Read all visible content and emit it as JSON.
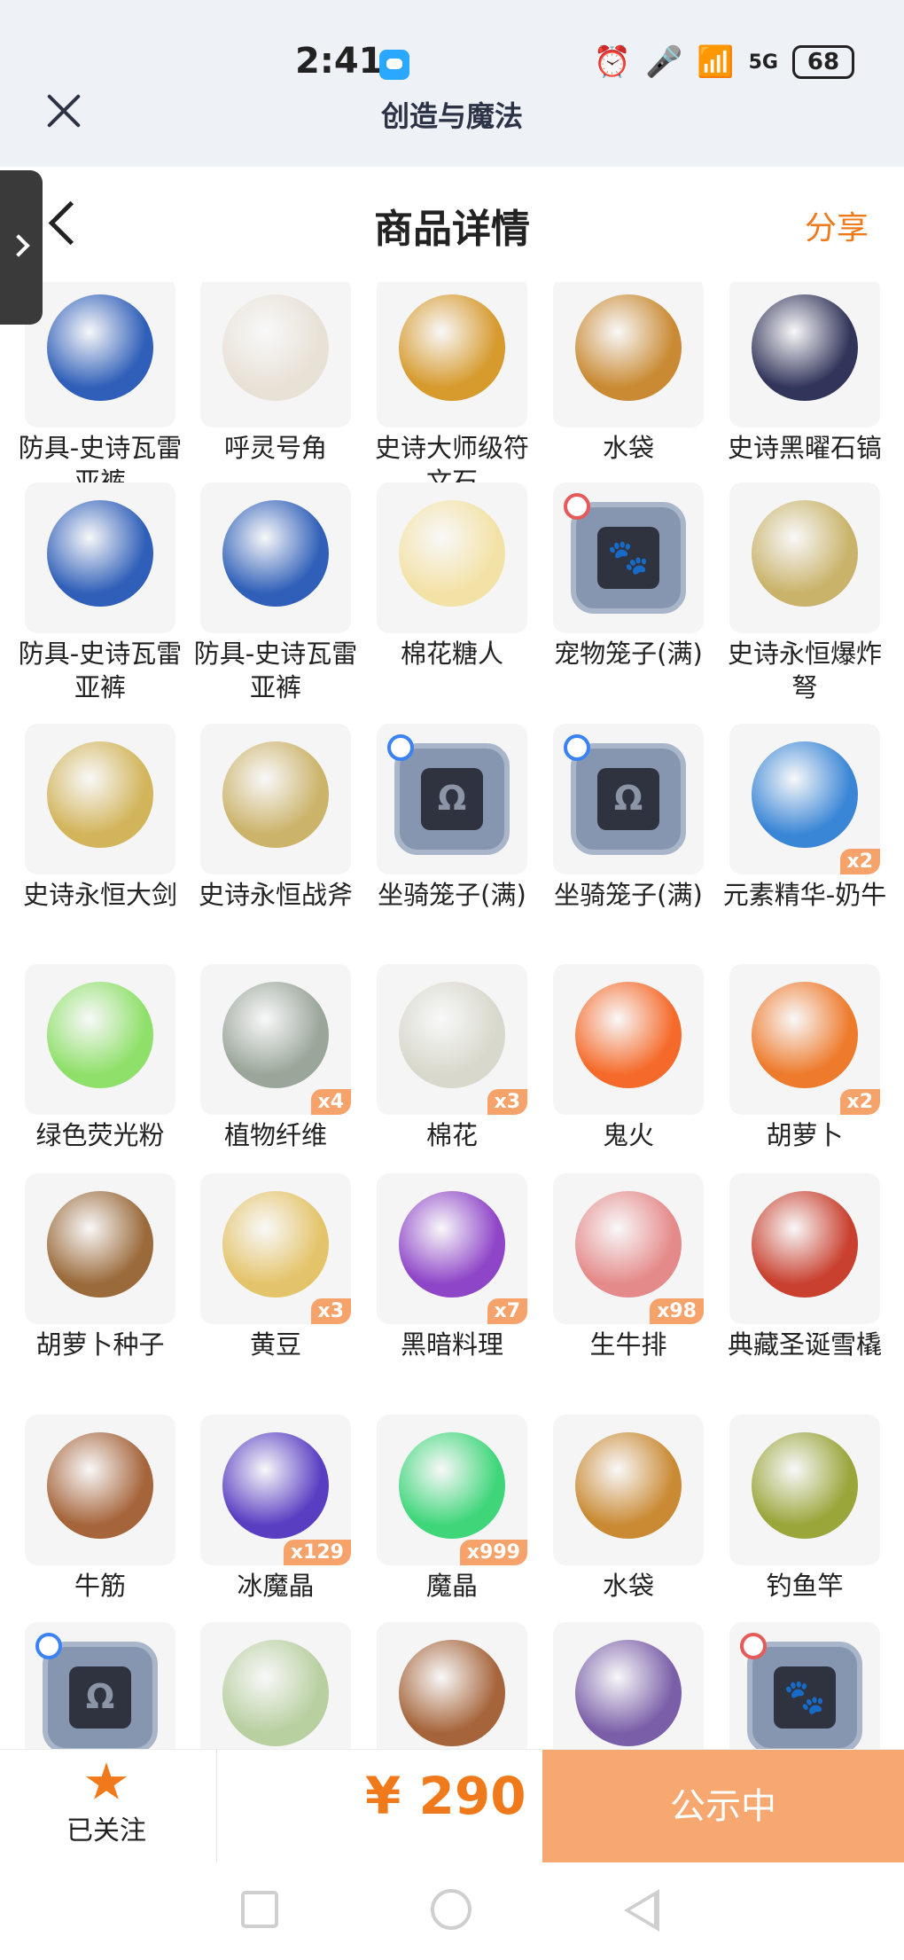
{
  "status_bar": {
    "time": "2:41",
    "network": "5G",
    "battery": "68"
  },
  "app": {
    "title": "创造与魔法"
  },
  "header": {
    "title": "商品详情",
    "share_label": "分享"
  },
  "items": [
    {
      "name": "防具-史诗瓦雷亚裤",
      "qty": "",
      "color": "#2f5fb8"
    },
    {
      "name": "呼灵号角",
      "qty": "",
      "color": "#e8e1d6"
    },
    {
      "name": "史诗大师级符文石",
      "qty": "",
      "color": "#d69a2d"
    },
    {
      "name": "水袋",
      "qty": "",
      "color": "#c98a33"
    },
    {
      "name": "史诗黑曜石镐",
      "qty": "",
      "color": "#32355a"
    },
    {
      "name": "防具-史诗瓦雷亚裤",
      "qty": "",
      "color": "#2f5fb8"
    },
    {
      "name": "防具-史诗瓦雷亚裤",
      "qty": "",
      "color": "#2f5fb8"
    },
    {
      "name": "棉花糖人",
      "qty": "",
      "color": "#f3e2a6"
    },
    {
      "name": "宠物笼子(满)",
      "qty": "",
      "color": "cage-pet"
    },
    {
      "name": "史诗永恒爆炸弩",
      "qty": "",
      "color": "#c9b36a"
    },
    {
      "name": "史诗永恒大剑",
      "qty": "",
      "color": "#d2b45a"
    },
    {
      "name": "史诗永恒战斧",
      "qty": "",
      "color": "#cbb36a"
    },
    {
      "name": "坐骑笼子(满)",
      "qty": "",
      "color": "cage-mount"
    },
    {
      "name": "坐骑笼子(满)",
      "qty": "",
      "color": "cage-mount"
    },
    {
      "name": "元素精华-奶牛",
      "qty": "x2",
      "color": "#3a86d6"
    },
    {
      "name": "绿色荧光粉",
      "qty": "",
      "color": "#8fe06a"
    },
    {
      "name": "植物纤维",
      "qty": "x4",
      "color": "#9aa69a"
    },
    {
      "name": "棉花",
      "qty": "x3",
      "color": "#d8d8cc"
    },
    {
      "name": "鬼火",
      "qty": "",
      "color": "#f56a2a"
    },
    {
      "name": "胡萝卜",
      "qty": "x2",
      "color": "#ee7a2b"
    },
    {
      "name": "胡萝卜种子",
      "qty": "",
      "color": "#9a6a3a"
    },
    {
      "name": "黄豆",
      "qty": "x3",
      "color": "#e4c46a"
    },
    {
      "name": "黑暗料理",
      "qty": "x7",
      "color": "#8e45c8"
    },
    {
      "name": "生牛排",
      "qty": "x98",
      "color": "#e58a8a"
    },
    {
      "name": "典藏圣诞雪橇",
      "qty": "",
      "color": "#c9402f"
    },
    {
      "name": "牛筋",
      "qty": "",
      "color": "#a5643a"
    },
    {
      "name": "冰魔晶",
      "qty": "x129",
      "color": "#5a3ec2"
    },
    {
      "name": "魔晶",
      "qty": "x999",
      "color": "#3fd67a"
    },
    {
      "name": "水袋",
      "qty": "",
      "color": "#c98a33"
    },
    {
      "name": "钓鱼竿",
      "qty": "",
      "color": "#9aa53a"
    },
    {
      "name": "",
      "qty": "",
      "color": "cage-mount"
    },
    {
      "name": "",
      "qty": "",
      "color": "#b8cfa0"
    },
    {
      "name": "",
      "qty": "",
      "color": "#a5643a"
    },
    {
      "name": "",
      "qty": "",
      "color": "#7a5fa8"
    },
    {
      "name": "",
      "qty": "",
      "color": "cage-pet"
    }
  ],
  "bottom": {
    "follow_label": "已关注",
    "price": "¥ 290",
    "cta_label": "公示中"
  },
  "theme": {
    "accent": "#f07a1b",
    "cta_bg": "#f6a870"
  }
}
